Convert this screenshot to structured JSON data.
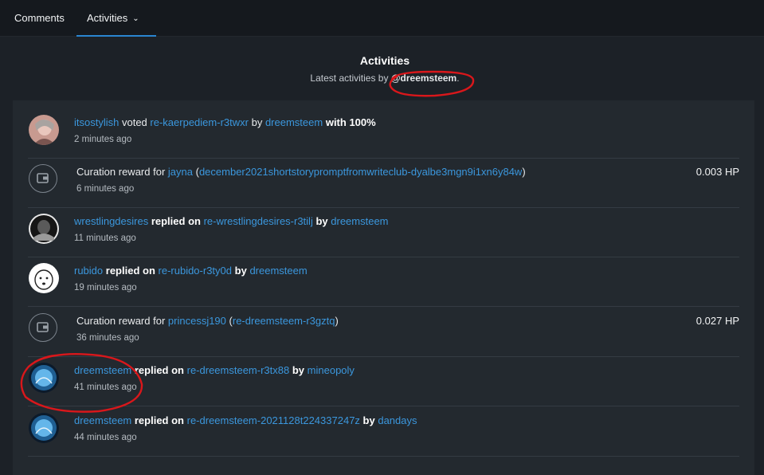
{
  "tabs": {
    "comments": "Comments",
    "activities": "Activities",
    "activities_chevron": "⌄"
  },
  "header": {
    "title": "Activities",
    "subtitle_prefix": "Latest activities by ",
    "username": "@dreemsteem",
    "subtitle_suffix": "."
  },
  "activities": [
    {
      "user": "itsostylish",
      "verb": "voted",
      "post": "re-kaerpediem-r3twxr",
      "by": "by",
      "author": "dreemsteem",
      "with": "with",
      "weight": "100%",
      "time": "2 minutes ago"
    },
    {
      "label": "Curation reward for",
      "user": "jayna",
      "open": "(",
      "post": "december2021shortstorypromptfromwriteclub-dyalbe3mgn9i1xn6y84w",
      "close": ")",
      "amount": "0.003 HP",
      "time": "6 minutes ago"
    },
    {
      "user": "wrestlingdesires",
      "verb": "replied on",
      "post": "re-wrestlingdesires-r3tilj",
      "by": "by",
      "author": "dreemsteem",
      "time": "11 minutes ago"
    },
    {
      "user": "rubido",
      "verb": "replied on",
      "post": "re-rubido-r3ty0d",
      "by": "by",
      "author": "dreemsteem",
      "time": "19 minutes ago"
    },
    {
      "label": "Curation reward for",
      "user": "princessj190",
      "open": "(",
      "post": "re-dreemsteem-r3gztq",
      "close": ")",
      "amount": "0.027 HP",
      "time": "36 minutes ago"
    },
    {
      "user": "dreemsteem",
      "verb": "replied on",
      "post": "re-dreemsteem-r3tx88",
      "by": "by",
      "author": "mineopoly",
      "time": "41 minutes ago"
    },
    {
      "user": "dreemsteem",
      "verb": "replied on",
      "post": "re-dreemsteem-2021128t224337247z",
      "by": "by",
      "author": "dandays",
      "time": "44 minutes ago"
    }
  ],
  "colors": {
    "background": "#1c2127",
    "panel": "#23292f",
    "link": "#3b97dd",
    "annotation": "#d9171b",
    "tab_underline": "#2a86d1"
  }
}
